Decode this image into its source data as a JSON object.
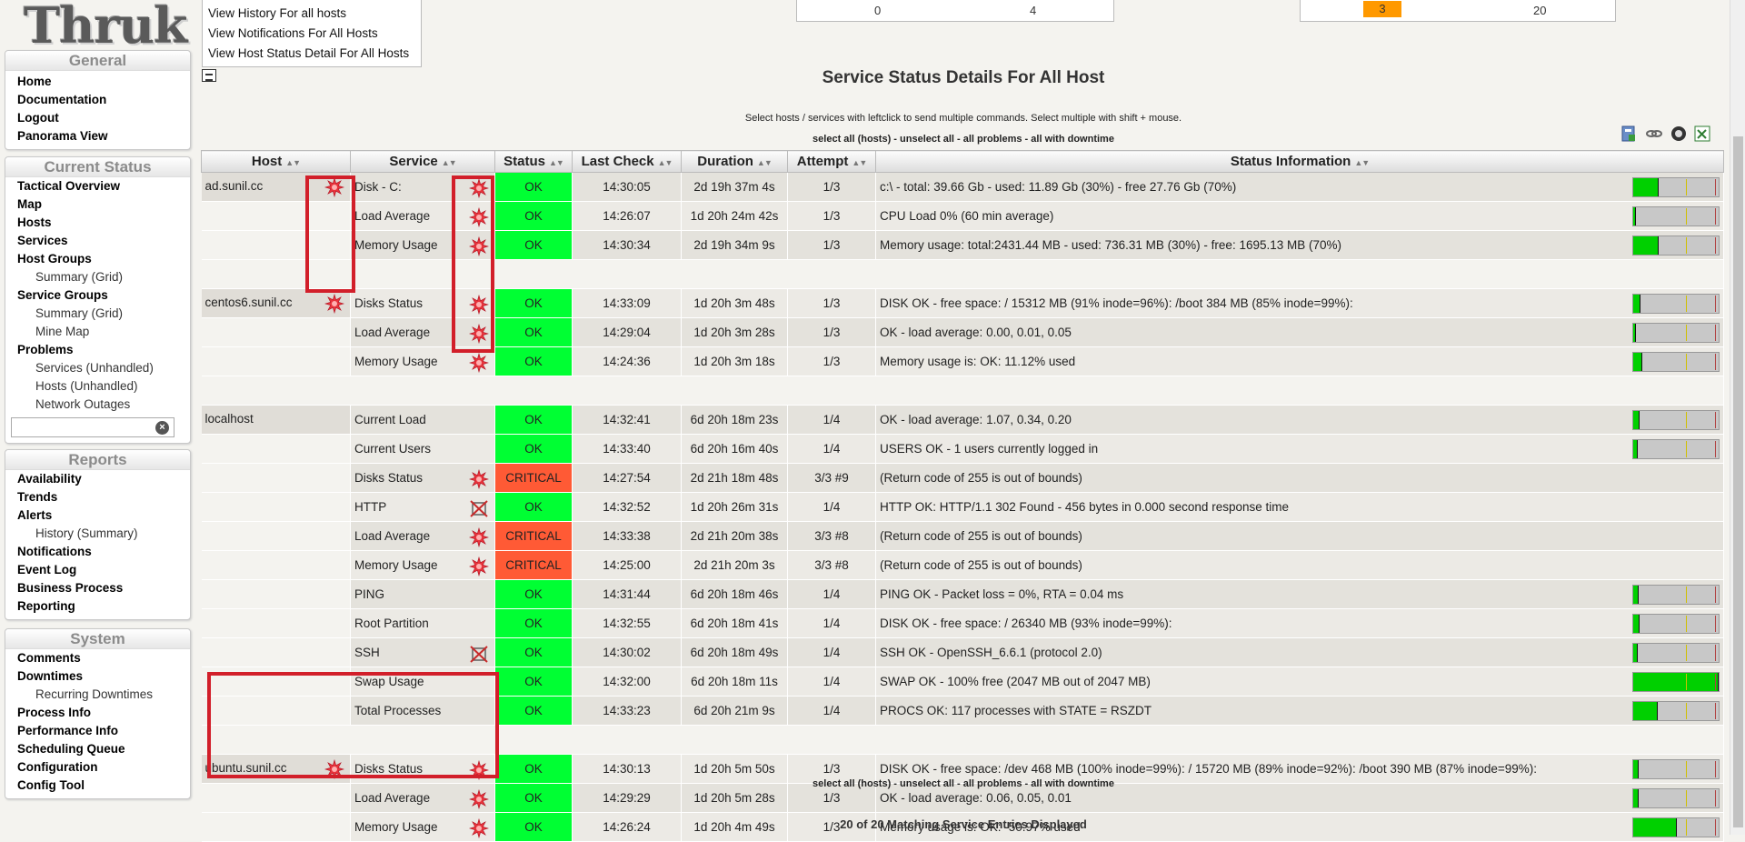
{
  "app": {
    "logo": "Thruk"
  },
  "sidebar": {
    "general": {
      "title": "General",
      "items": [
        "Home",
        "Documentation",
        "Logout",
        "Panorama View"
      ]
    },
    "current_status": {
      "title": "Current Status",
      "items": [
        {
          "label": "Tactical Overview",
          "sub": false
        },
        {
          "label": "Map",
          "sub": false
        },
        {
          "label": "Hosts",
          "sub": false
        },
        {
          "label": "Services",
          "sub": false
        },
        {
          "label": "Host Groups",
          "sub": false
        },
        {
          "label": "Summary (Grid)",
          "sub": true
        },
        {
          "label": "Service Groups",
          "sub": false
        },
        {
          "label": "Summary (Grid)",
          "sub": true
        },
        {
          "label": "Mine Map",
          "sub": true
        },
        {
          "label": "Problems",
          "sub": false
        },
        {
          "label": "Services (Unhandled)",
          "sub": true
        },
        {
          "label": "Hosts (Unhandled)",
          "sub": true
        },
        {
          "label": "Network Outages",
          "sub": true
        }
      ],
      "search_value": ""
    },
    "reports": {
      "title": "Reports",
      "items": [
        {
          "label": "Availability",
          "sub": false
        },
        {
          "label": "Trends",
          "sub": false
        },
        {
          "label": "Alerts",
          "sub": false
        },
        {
          "label": "History (Summary)",
          "sub": true
        },
        {
          "label": "Notifications",
          "sub": false
        },
        {
          "label": "Event Log",
          "sub": false
        },
        {
          "label": "Business Process",
          "sub": false
        },
        {
          "label": "Reporting",
          "sub": false
        }
      ]
    },
    "system": {
      "title": "System",
      "items": [
        {
          "label": "Comments",
          "sub": false
        },
        {
          "label": "Downtimes",
          "sub": false
        },
        {
          "label": "Recurring Downtimes",
          "sub": true
        },
        {
          "label": "Process Info",
          "sub": false
        },
        {
          "label": "Performance Info",
          "sub": false
        },
        {
          "label": "Scheduling Queue",
          "sub": false
        },
        {
          "label": "Configuration",
          "sub": false
        },
        {
          "label": "Config Tool",
          "sub": false
        }
      ]
    }
  },
  "quicklinks": [
    "View History For all hosts",
    "View Notifications For All Hosts",
    "View Host Status Detail For All Hosts"
  ],
  "host_totals": [
    "0",
    "4"
  ],
  "service_totals": [
    "3",
    "20"
  ],
  "colors": {
    "ok": "#00ff33",
    "critical": "#ff5a35",
    "warning_badge": "#ff9900",
    "annotation": "#d21f2a"
  },
  "page": {
    "title": "Service Status Details For All Host",
    "hint": "Select hosts / services with leftclick to send multiple commands. Select multiple with shift + mouse.",
    "select_all": "select all (hosts) - unselect all - all problems - all with downtime",
    "footer": "20 of 20 Matching Service Entries Displayed"
  },
  "table": {
    "columns": [
      "Host",
      "Service",
      "Status",
      "Last Check",
      "Duration",
      "Attempt",
      "Status Information"
    ],
    "groups": [
      {
        "host": "ad.sunil.cc",
        "host_icon": "notifications-disabled-burst-icon",
        "rows": [
          {
            "service": "Disk - C:",
            "icon": "burst",
            "status": "OK",
            "last_check": "14:30:05",
            "duration": "2d 19h 37m 4s",
            "attempt": "1/3",
            "info": "c:\\ - total: 39.66 Gb - used: 11.89 Gb (30%) - free 27.76 Gb (70%)",
            "perf": 0.3
          },
          {
            "service": "Load Average",
            "icon": "burst",
            "status": "OK",
            "last_check": "14:26:07",
            "duration": "1d 20h 24m 42s",
            "attempt": "1/3",
            "info": "CPU Load 0% (60 min average)",
            "perf": 0.02
          },
          {
            "service": "Memory Usage",
            "icon": "burst",
            "status": "OK",
            "last_check": "14:30:34",
            "duration": "2d 19h 34m 9s",
            "attempt": "1/3",
            "info": "Memory usage: total:2431.44 MB - used: 736.31 MB (30%) - free: 1695.13 MB (70%)",
            "perf": 0.3
          }
        ]
      },
      {
        "host": "centos6.sunil.cc",
        "host_icon": "notifications-disabled-burst-icon",
        "rows": [
          {
            "service": "Disks Status",
            "icon": "burst",
            "status": "OK",
            "last_check": "14:33:09",
            "duration": "1d 20h 3m 48s",
            "attempt": "1/3",
            "info": "DISK OK - free space: / 15312 MB (91% inode=96%): /boot 384 MB (85% inode=99%):",
            "perf": 0.09
          },
          {
            "service": "Load Average",
            "icon": "burst",
            "status": "OK",
            "last_check": "14:29:04",
            "duration": "1d 20h 3m 28s",
            "attempt": "1/3",
            "info": "OK - load average: 0.00, 0.01, 0.05",
            "perf": 0.02
          },
          {
            "service": "Memory Usage",
            "icon": "burst",
            "status": "OK",
            "last_check": "14:24:36",
            "duration": "1d 20h 3m 18s",
            "attempt": "1/3",
            "info": "Memory usage is: OK: 11.12% used",
            "perf": 0.11
          }
        ]
      },
      {
        "host": "localhost",
        "host_icon": "",
        "rows": [
          {
            "service": "Current Load",
            "icon": "",
            "status": "OK",
            "last_check": "14:32:41",
            "duration": "6d 20h 18m 23s",
            "attempt": "1/4",
            "info": "OK - load average: 1.07, 0.34, 0.20",
            "perf": 0.07
          },
          {
            "service": "Current Users",
            "icon": "",
            "status": "OK",
            "last_check": "14:33:40",
            "duration": "6d 20h 16m 40s",
            "attempt": "1/4",
            "info": "USERS OK - 1 users currently logged in",
            "perf": 0.05
          },
          {
            "service": "Disks Status",
            "icon": "burst",
            "status": "CRITICAL",
            "last_check": "14:27:54",
            "duration": "2d 21h 18m 48s",
            "attempt": "3/3 #9",
            "info": "(Return code of 255 is out of bounds)",
            "perf": null
          },
          {
            "service": "HTTP",
            "icon": "crossed",
            "status": "OK",
            "last_check": "14:32:52",
            "duration": "1d 20h 26m 31s",
            "attempt": "1/4",
            "info": "HTTP OK: HTTP/1.1 302 Found - 456 bytes in 0.000 second response time",
            "perf": null
          },
          {
            "service": "Load Average",
            "icon": "burst",
            "status": "CRITICAL",
            "last_check": "14:33:38",
            "duration": "2d 21h 20m 38s",
            "attempt": "3/3 #8",
            "info": "(Return code of 255 is out of bounds)",
            "perf": null
          },
          {
            "service": "Memory Usage",
            "icon": "burst",
            "status": "CRITICAL",
            "last_check": "14:25:00",
            "duration": "2d 21h 20m 3s",
            "attempt": "3/3 #8",
            "info": "(Return code of 255 is out of bounds)",
            "perf": null
          },
          {
            "service": "PING",
            "icon": "",
            "status": "OK",
            "last_check": "14:31:44",
            "duration": "6d 20h 18m 46s",
            "attempt": "1/4",
            "info": "PING OK - Packet loss = 0%, RTA = 0.04 ms",
            "perf": 0.06
          },
          {
            "service": "Root Partition",
            "icon": "",
            "status": "OK",
            "last_check": "14:32:55",
            "duration": "6d 20h 18m 41s",
            "attempt": "1/4",
            "info": "DISK OK - free space: / 26340 MB (93% inode=99%):",
            "perf": 0.07
          },
          {
            "service": "SSH",
            "icon": "crossed",
            "status": "OK",
            "last_check": "14:30:02",
            "duration": "6d 20h 18m 49s",
            "attempt": "1/4",
            "info": "SSH OK - OpenSSH_6.6.1 (protocol 2.0)",
            "perf": 0.05
          },
          {
            "service": "Swap Usage",
            "icon": "",
            "status": "OK",
            "last_check": "14:32:00",
            "duration": "6d 20h 18m 11s",
            "attempt": "1/4",
            "info": "SWAP OK - 100% free (2047 MB out of 2047 MB)",
            "perf": 1.0
          },
          {
            "service": "Total Processes",
            "icon": "",
            "status": "OK",
            "last_check": "14:33:23",
            "duration": "6d 20h 21m 9s",
            "attempt": "1/4",
            "info": "PROCS OK: 117 processes with STATE = RSZDT",
            "perf": 0.29
          }
        ]
      },
      {
        "host": "ubuntu.sunil.cc",
        "host_icon": "notifications-disabled-burst-icon",
        "rows": [
          {
            "service": "Disks Status",
            "icon": "burst",
            "status": "OK",
            "last_check": "14:30:13",
            "duration": "1d 20h 5m 50s",
            "attempt": "1/3",
            "info": "DISK OK - free space: /dev 468 MB (100% inode=99%): / 15720 MB (89% inode=92%): /boot 390 MB (87% inode=99%):",
            "perf": 0.06
          },
          {
            "service": "Load Average",
            "icon": "burst",
            "status": "OK",
            "last_check": "14:29:29",
            "duration": "1d 20h 5m 28s",
            "attempt": "1/3",
            "info": "OK - load average: 0.06, 0.05, 0.01",
            "perf": 0.06
          },
          {
            "service": "Memory Usage",
            "icon": "burst",
            "status": "OK",
            "last_check": "14:26:24",
            "duration": "1d 20h 4m 49s",
            "attempt": "1/3",
            "info": "Memory usage is: OK: -50.97% used",
            "perf": 0.51
          }
        ]
      }
    ]
  }
}
